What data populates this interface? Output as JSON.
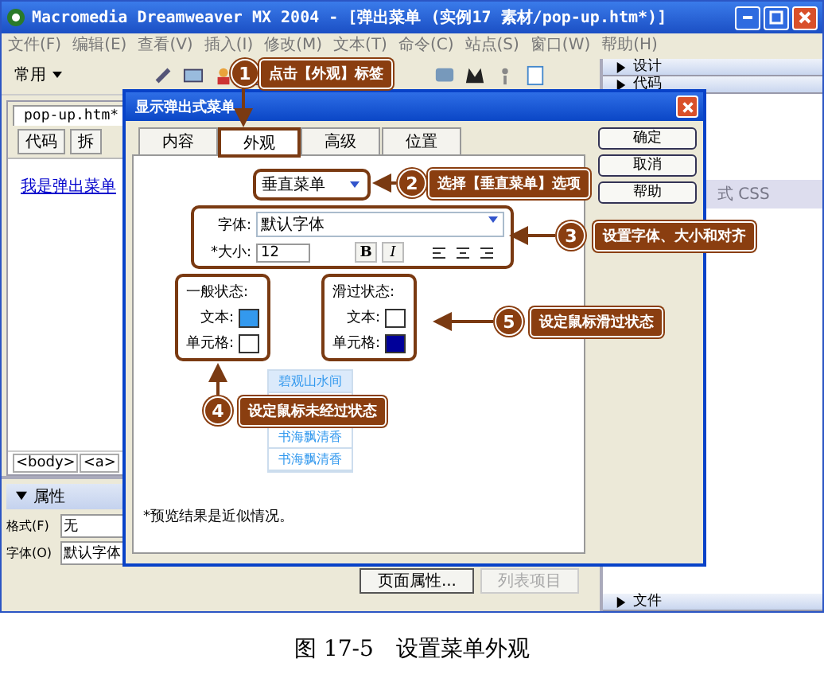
{
  "window": {
    "title": "Macromedia Dreamweaver MX 2004 - [弹出菜单 (实例17 素材/pop-up.htm*)]"
  },
  "menu": [
    "文件(F)",
    "编辑(E)",
    "查看(V)",
    "插入(I)",
    "修改(M)",
    "文本(T)",
    "命令(C)",
    "站点(S)",
    "窗口(W)",
    "帮助(H)"
  ],
  "toolbar": {
    "category": "常用"
  },
  "document": {
    "tab": "pop-up.htm*",
    "view_buttons": [
      "代码",
      "拆"
    ],
    "link": "我是弹出菜单",
    "tag_path": [
      "<body>",
      "<a>"
    ]
  },
  "properties": {
    "title": "属性",
    "rows": [
      {
        "label": "格式(F)",
        "value": "无"
      },
      {
        "label": "字体(O)",
        "value": "默认字体"
      }
    ],
    "buttons": [
      {
        "label": "页面属性...",
        "disabled": false
      },
      {
        "label": "列表项目",
        "disabled": true
      }
    ]
  },
  "panels": {
    "top": [
      "设计",
      "代码"
    ],
    "css_label": "式 CSS",
    "bottom": [
      "文件"
    ]
  },
  "dialog": {
    "title": "显示弹出式菜单",
    "tabs": [
      {
        "label": "内容",
        "selected": false
      },
      {
        "label": "外观",
        "selected": true
      },
      {
        "label": "高级",
        "selected": false
      },
      {
        "label": "位置",
        "selected": false
      }
    ],
    "buttons": [
      "确定",
      "取消",
      "帮助"
    ],
    "menu_type": "垂直菜单",
    "font_label": "字体:",
    "font": "默认字体",
    "size_label": "*大小:",
    "size": "12",
    "bold": "B",
    "italic": "I",
    "states": [
      {
        "title": "一般状态:",
        "swatches": [
          {
            "label": "文本:",
            "color": "#3399ee"
          },
          {
            "label": "单元格:",
            "color": "#ffffff"
          }
        ]
      },
      {
        "title": "滑过状态:",
        "swatches": [
          {
            "label": "文本:",
            "color": "#ffffff"
          },
          {
            "label": "单元格:",
            "color": "#000099"
          }
        ]
      }
    ],
    "preview": [
      {
        "label": "碧观山水间",
        "selected": true
      },
      {
        "label": "书海飘清香",
        "selected": false
      },
      {
        "label": "书海飘清香",
        "selected": false
      }
    ],
    "note": "*预览结果是近似情况。"
  },
  "callouts": [
    {
      "number": "1",
      "text": "点击【外观】标签"
    },
    {
      "number": "2",
      "text": "选择【垂直菜单】选项"
    },
    {
      "number": "3",
      "text": "设置字体、大小和对齐"
    },
    {
      "number": "4",
      "text": "设定鼠标未经过状态"
    },
    {
      "number": "5",
      "text": "设定鼠标滑过状态"
    }
  ],
  "caption": "图 17-5　设置菜单外观"
}
